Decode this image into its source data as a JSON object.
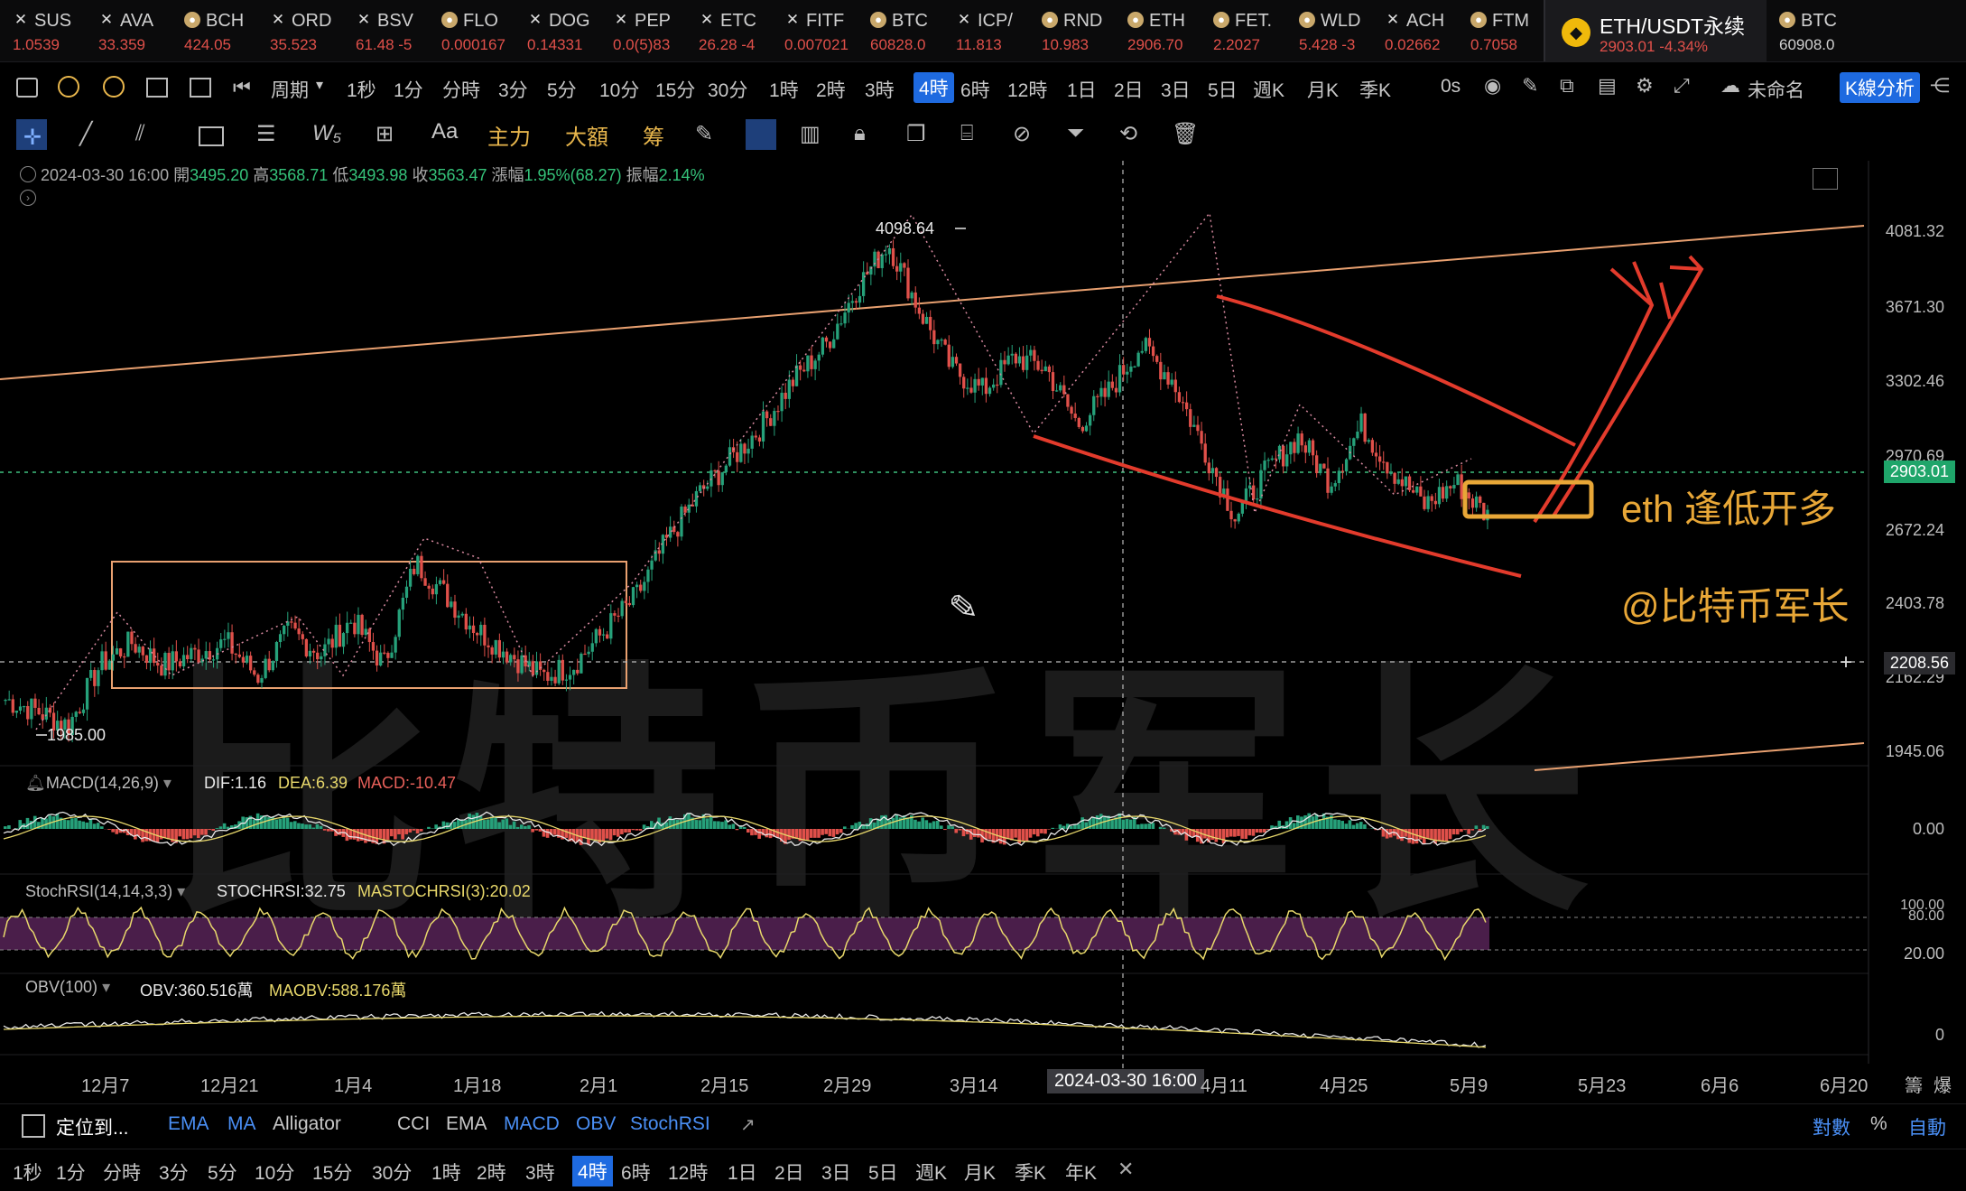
{
  "tickers": [
    {
      "name": "SUS",
      "price": "1.0539",
      "icon": "x"
    },
    {
      "name": "AVA",
      "price": "33.359",
      "icon": "x"
    },
    {
      "name": "BCH",
      "price": "424.05",
      "icon": "coin"
    },
    {
      "name": "ORD",
      "price": "35.523",
      "icon": "x"
    },
    {
      "name": "BSV",
      "price": "61.48 -5",
      "icon": "x"
    },
    {
      "name": "FLO",
      "price": "0.000167",
      "icon": "coin"
    },
    {
      "name": "DOG",
      "price": "0.14331",
      "icon": "x"
    },
    {
      "name": "PEP",
      "price": "0.0(5)83",
      "icon": "x"
    },
    {
      "name": "ETC",
      "price": "26.28 -4",
      "icon": "x"
    },
    {
      "name": "FITF",
      "price": "0.007021",
      "icon": "x"
    },
    {
      "name": "BTC",
      "price": "60828.0",
      "icon": "coin"
    },
    {
      "name": "ICP/",
      "price": "11.813",
      "icon": "x"
    },
    {
      "name": "RND",
      "price": "10.983",
      "icon": "coin"
    },
    {
      "name": "ETH",
      "price": "2906.70",
      "icon": "coin"
    },
    {
      "name": "FET.",
      "price": "2.2027",
      "icon": "coin"
    },
    {
      "name": "WLD",
      "price": "5.428 -3",
      "icon": "coin"
    },
    {
      "name": "ACH",
      "price": "0.02662",
      "icon": "x"
    },
    {
      "name": "FTM",
      "price": "0.7058",
      "icon": "coin"
    }
  ],
  "active_ticker": {
    "name": "ETH/USDT永续",
    "price": "2903.01",
    "change": "-4.34%"
  },
  "last_ticker": {
    "name": "BTC",
    "price": "60908.0"
  },
  "toolbar1": {
    "period_label": "周期",
    "intervals": [
      "1秒",
      "1分",
      "分時",
      "3分",
      "5分",
      "10分",
      "15分",
      "30分",
      "1時",
      "2時",
      "3時",
      "4時",
      "6時",
      "12時",
      "1日",
      "2日",
      "3日",
      "5日",
      "週K",
      "月K",
      "季K"
    ],
    "active": "4時",
    "countdown": "0s",
    "layout_name": "未命名",
    "analysis_button": "K線分析"
  },
  "toolbar2": {
    "text_tool": "Aa",
    "main_force": "主力",
    "big_amount": "大額",
    "chips": "筹"
  },
  "info": {
    "datetime": "2024-03-30 16:00",
    "open_label": "開",
    "open": "3495.20",
    "high_label": "高",
    "high": "3568.71",
    "low_label": "低",
    "low": "3493.98",
    "close_label": "收",
    "close": "3563.47",
    "chg_label": "漲幅",
    "chg": "1.95%(68.27)",
    "amp_label": "振幅",
    "amp": "2.14%"
  },
  "y_axis": [
    "4081.32",
    "3671.30",
    "3302.46",
    "2970.69",
    "2672.24",
    "2403.78",
    "2162.29",
    "1945.06"
  ],
  "price_tag": "2903.01",
  "cursor_tag": "2208.56",
  "annotations": {
    "high": "4098.64",
    "low": "1985.00",
    "text1": "eth 逢低开多",
    "text2": "@比特币军长",
    "watermark": "比特币军长"
  },
  "macd": {
    "label": "MACD(14,26,9)",
    "dif": "DIF:1.16",
    "dea": "DEA:6.39",
    "macd": "MACD:-10.47",
    "zero": "0.00"
  },
  "stoch": {
    "label": "StochRSI(14,14,3,3)",
    "k": "STOCHRSI:32.75",
    "d": "MASTOCHRSI(3):20.02",
    "top": "100.00",
    "upper": "80.00",
    "lower": "20.00"
  },
  "obv": {
    "label": "OBV(100)",
    "v": "OBV:360.516萬",
    "ma": "MAOBV:588.176萬",
    "zero": "0"
  },
  "x_axis": [
    "12月7",
    "12月21",
    "1月4",
    "1月18",
    "2月1",
    "2月15",
    "2月29",
    "3月14",
    "4月11",
    "4月25",
    "5月9",
    "5月23",
    "6月6",
    "6月20"
  ],
  "x_cursor": "2024-03-30 16:00",
  "x_right": [
    "籌",
    "爆"
  ],
  "bottom1": {
    "locate": "定位到...",
    "items": [
      "EMA",
      "MA",
      "Alligator",
      "CCI",
      "EMA",
      "MACD",
      "OBV",
      "StochRSI"
    ],
    "log": "對數",
    "pct": "%",
    "auto": "自動"
  },
  "bottom2": {
    "intervals": [
      "1秒",
      "1分",
      "分時",
      "3分",
      "5分",
      "10分",
      "15分",
      "30分",
      "1時",
      "2時",
      "3時",
      "4時",
      "6時",
      "12時",
      "1日",
      "2日",
      "3日",
      "5日",
      "週K",
      "月K",
      "季K",
      "年K"
    ],
    "active": "4時"
  },
  "chart_data": {
    "type": "candlestick",
    "series": [
      {
        "name": "ETH/USDT永续",
        "values": [
          2100,
          2050,
          1985,
          2250,
          2350,
          2250,
          2300,
          2350,
          2200,
          2400,
          2300,
          2450,
          2250,
          2700,
          2550,
          2400,
          2300,
          2200,
          2250,
          2400,
          2550,
          2800,
          3000,
          3150,
          3300,
          3500,
          3650,
          3900,
          4098.64,
          3800,
          3550,
          3450,
          3600,
          3550,
          3300,
          3450,
          3650,
          3500,
          3200,
          2900,
          3100,
          3250,
          3050,
          3300,
          3100,
          2950,
          3050,
          2903.01
        ]
      }
    ]
  },
  "colors": {
    "up": "#26a17a",
    "down": "#e0504a",
    "accent": "#1e6ae0",
    "annotation": "#e8a737",
    "trendline": "#e33b2c"
  }
}
